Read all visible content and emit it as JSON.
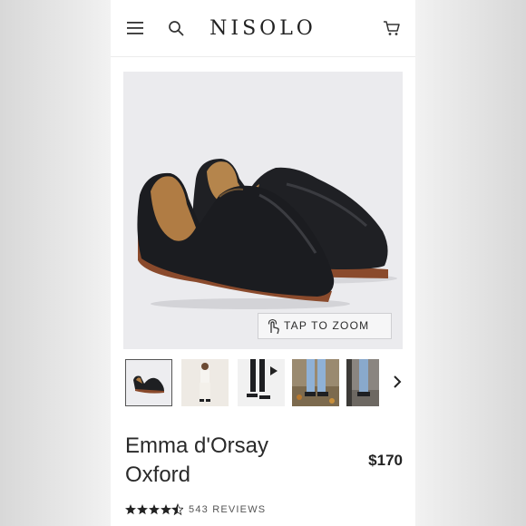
{
  "header": {
    "logo": "NISOLO",
    "menu_icon": "hamburger-menu-icon",
    "search_icon": "search-icon",
    "cart_icon": "shopping-cart-icon"
  },
  "gallery": {
    "zoom_label": "TAP TO ZOOM",
    "zoom_icon": "tap-finger-icon",
    "thumbnails": [
      {
        "name": "shoe-pair",
        "active": true
      },
      {
        "name": "model-white-outfit",
        "active": false
      },
      {
        "name": "video-model-black-pants",
        "active": false,
        "video": true
      },
      {
        "name": "model-jeans-leaves",
        "active": false
      },
      {
        "name": "model-jeans-stairs",
        "active": false
      }
    ],
    "next_icon": "chevron-right-icon"
  },
  "product": {
    "title_line1": "Emma d'Orsay",
    "title_line2": "Oxford",
    "price": "$170",
    "rating": 4.5,
    "reviews_label": "543 REVIEWS"
  },
  "colors": {
    "text": "#222222",
    "hero_bg": "#ebebee",
    "leather": "#1e1f22",
    "sole": "#8a4a2c"
  }
}
